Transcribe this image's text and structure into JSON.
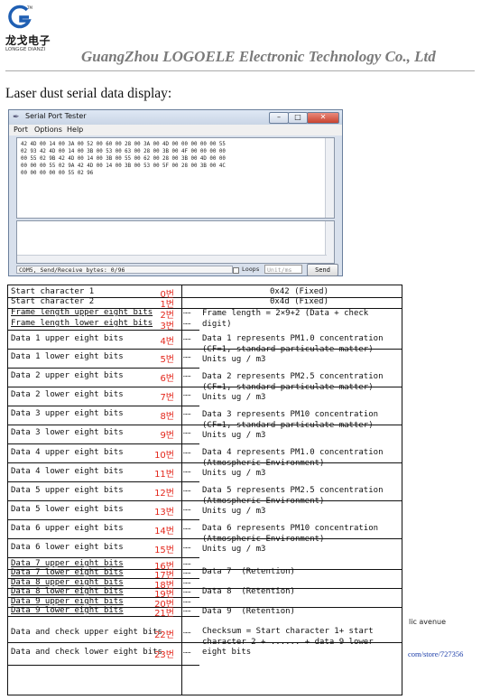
{
  "header": {
    "logo_text": "龙戈电子",
    "logo_sub": "LONGGE DIANZI",
    "company": "GuangZhou LOGOELE Electronic Technology Co., Ltd"
  },
  "heading": "Laser dust serial data display:",
  "window": {
    "title": "Serial Port Tester",
    "menu": [
      "Port",
      "Options",
      "Help"
    ],
    "received": "42 4D 00 14 00 3A 00 52 00 60 00 28 00 3A 00 4D 00 00 00 00 00 55\n02 93 42 4D 00 14 00 3B 00 53 00 63 00 28 00 3B 00 4F 00 00 00 00\n00 55 02 9B 42 4D 00 14 00 3B 00 55 00 62 00 28 00 3B 00 4D 00 00\n00 00 00 55 02 9A 42 4D 00 14 00 3B 00 53 00 5F 00 28 00 3B 00 4C\n00 00 00 00 00 55 02 96",
    "status": "COM5, Send/Receive bytes: 0/96",
    "loops_label": "Loops",
    "units_placeholder": "Unit/ms",
    "send_label": "Send"
  },
  "rows": [
    {
      "label": "Start character 1",
      "num": "0번"
    },
    {
      "label": "Start character 2",
      "num": "1번"
    },
    {
      "label": "Frame length upper eight bits",
      "num": "2번"
    },
    {
      "label": "Frame length lower eight bits",
      "num": "3번"
    },
    {
      "label": "Data 1 upper eight bits",
      "num": "4번"
    },
    {
      "label": "Data 1 lower eight bits",
      "num": "5번"
    },
    {
      "label": "Data 2 upper eight bits",
      "num": "6번"
    },
    {
      "label": "Data 2 lower eight bits",
      "num": "7번"
    },
    {
      "label": "Data 3 upper eight bits",
      "num": "8번"
    },
    {
      "label": "Data 3 lower eight bits",
      "num": "9번"
    },
    {
      "label": "Data 4 upper eight bits",
      "num": "10번"
    },
    {
      "label": "Data 4 lower eight bits",
      "num": "11번"
    },
    {
      "label": "Data 5 upper eight bits",
      "num": "12번"
    },
    {
      "label": "Data 5 lower eight bits",
      "num": "13번"
    },
    {
      "label": "Data 6 upper eight bits",
      "num": "14번"
    },
    {
      "label": "Data 6 lower eight bits",
      "num": "15번"
    },
    {
      "label": "Data 7 upper eight bits",
      "num": "16번"
    },
    {
      "label": "Data 7 lower eight bits",
      "num": "17번"
    },
    {
      "label": "Data 8 upper eight bits",
      "num": "18번"
    },
    {
      "label": "Data 8 lower eight bits",
      "num": "19번"
    },
    {
      "label": "Data 9 upper eight bits",
      "num": "20번"
    },
    {
      "label": "Data 9 lower eight bits",
      "num": "21번"
    },
    {
      "label": "Data and check upper eight bits",
      "num": "22번"
    },
    {
      "label": "Data and check lower eight bits",
      "num": "23번"
    }
  ],
  "descriptions": {
    "start1": "0x42 (Fixed)",
    "start2": "0x4d (Fixed)",
    "frame": "Frame length = 2×9+2 (Data + check\ndigit)",
    "d1": "Data 1 represents PM1.0 concentration\n(CF=1, standard particulate matter)\nUnits ug / m3",
    "d2": "Data 2 represents PM2.5 concentration\n(CF=1, standard particulate matter)\nUnits ug / m3",
    "d3": "Data 3 represents PM10 concentration\n(CF=1, standard particulate matter)\nUnits ug / m3",
    "d4": "Data 4 represents PM1.0 concentration\n(Atmospheric Environment)\nUnits ug / m3",
    "d5": "Data 5 represents PM2.5 concentration\n(Atmospheric Environment)\nUnits ug / m3",
    "d6": "Data 6 represents PM10 concentration\n(Atmospheric Environment)\nUnits ug / m3",
    "d7": "Data 7  (Retention)",
    "d8": "Data 8  (Retention)",
    "d9": "Data 9  (Retention)",
    "check": "Checksum = Start character 1+ start\ncharacter 2 + ...... + data 9 lower\neight bits"
  },
  "dots": "……",
  "side_text_1": "lic avenue",
  "side_text_2": "com/store/727356"
}
